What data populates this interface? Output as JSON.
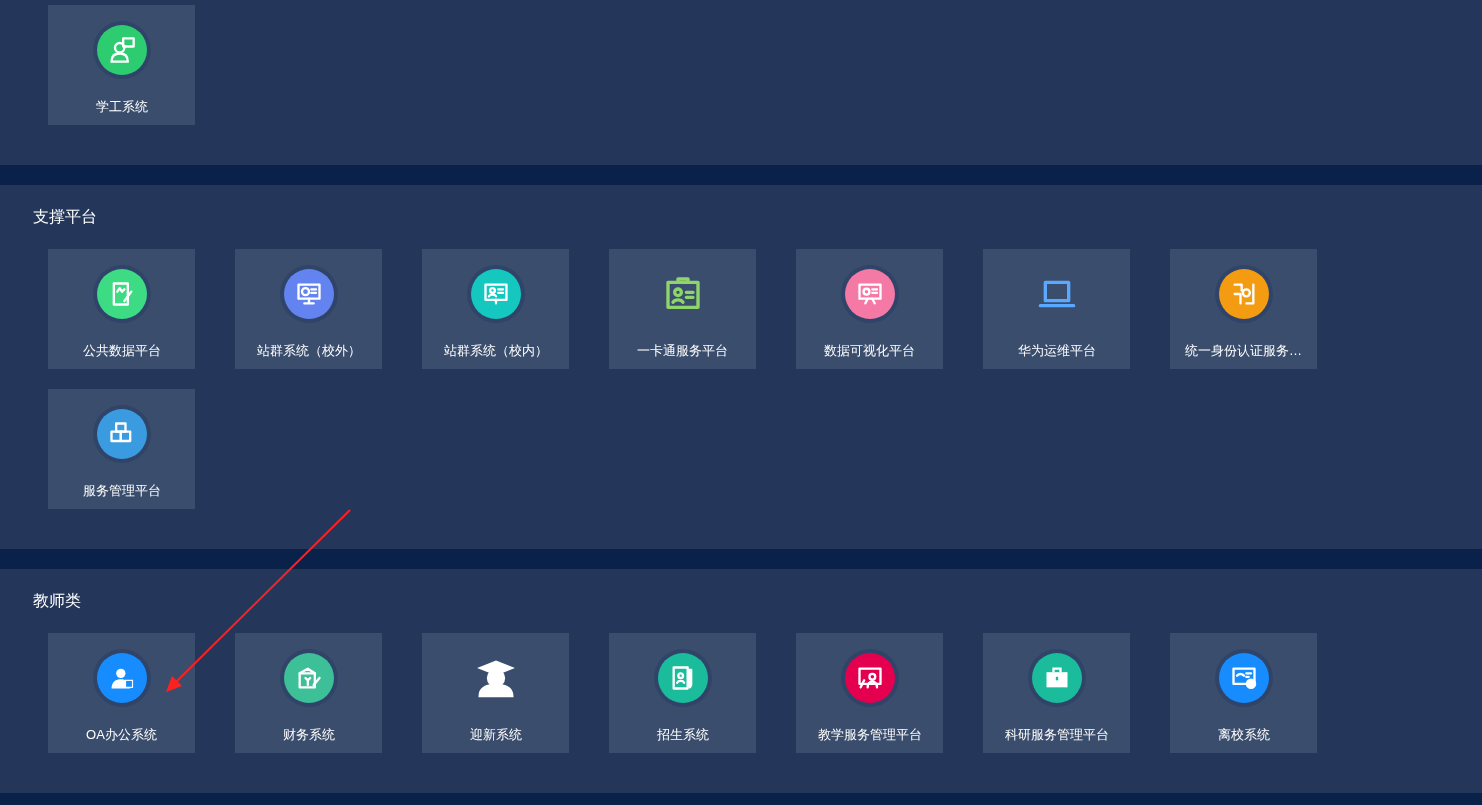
{
  "sections": [
    {
      "apps": [
        {
          "label": "学工系统",
          "color": "#2ecc71",
          "kind": "circle"
        }
      ]
    },
    {
      "title": "支撑平台",
      "apps": [
        {
          "label": "公共数据平台",
          "color": "#3ddc84",
          "kind": "circle"
        },
        {
          "label": "站群系统（校外）",
          "color": "#6384f0",
          "kind": "circle"
        },
        {
          "label": "站群系统（校内）",
          "color": "#14c8c0",
          "kind": "circle"
        },
        {
          "label": "一卡通服务平台",
          "color": "#8ed66b",
          "kind": "plain"
        },
        {
          "label": "数据可视化平台",
          "color": "#f47aa5",
          "kind": "circle"
        },
        {
          "label": "华为运维平台",
          "color": "#5aa9ff",
          "kind": "plain"
        },
        {
          "label": "统一身份认证服务…",
          "color": "#f39c12",
          "kind": "circle"
        },
        {
          "label": "服务管理平台",
          "color": "#3b9be0",
          "kind": "circle"
        }
      ]
    },
    {
      "title": "教师类",
      "apps": [
        {
          "label": "OA办公系统",
          "color": "#168cff",
          "kind": "circle"
        },
        {
          "label": "财务系统",
          "color": "#3dbf98",
          "kind": "circle"
        },
        {
          "label": "迎新系统",
          "color": "#ffffff",
          "kind": "plain"
        },
        {
          "label": "招生系统",
          "color": "#1abc9c",
          "kind": "circle"
        },
        {
          "label": "教学服务管理平台",
          "color": "#e5004f",
          "kind": "circle"
        },
        {
          "label": "科研服务管理平台",
          "color": "#1abc9c",
          "kind": "circle"
        },
        {
          "label": "离校系统",
          "color": "#168cff",
          "kind": "circle"
        }
      ]
    }
  ]
}
